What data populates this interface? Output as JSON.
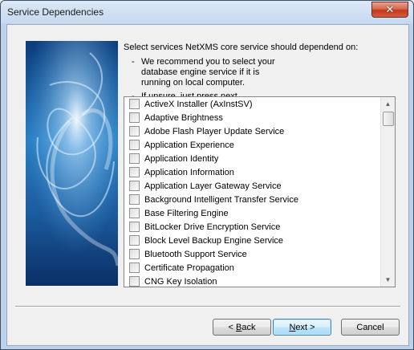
{
  "window": {
    "title": "Service Dependencies",
    "close_glyph": "✕"
  },
  "prompt": "Select services NetXMS core service should dependend on:",
  "bullets": [
    "We recommend you to select your database engine service if it is running on local computer.",
    "If unsure, just press next."
  ],
  "bullet_dash": "-",
  "services": [
    {
      "label": "ActiveX Installer (AxInstSV)",
      "checked": false
    },
    {
      "label": "Adaptive Brightness",
      "checked": false
    },
    {
      "label": "Adobe Flash Player Update Service",
      "checked": false
    },
    {
      "label": "Application Experience",
      "checked": false
    },
    {
      "label": "Application Identity",
      "checked": false
    },
    {
      "label": "Application Information",
      "checked": false
    },
    {
      "label": "Application Layer Gateway Service",
      "checked": false
    },
    {
      "label": "Background Intelligent Transfer Service",
      "checked": false
    },
    {
      "label": "Base Filtering Engine",
      "checked": false
    },
    {
      "label": "BitLocker Drive Encryption Service",
      "checked": false
    },
    {
      "label": "Block Level Backup Engine Service",
      "checked": false
    },
    {
      "label": "Bluetooth Support Service",
      "checked": false
    },
    {
      "label": "Certificate Propagation",
      "checked": false
    },
    {
      "label": "CNG Key Isolation",
      "checked": false
    }
  ],
  "scrollbar": {
    "up_icon": "▲",
    "down_icon": "▼"
  },
  "buttons": {
    "back": {
      "accel": "B",
      "rest": "ack",
      "prefix": "< "
    },
    "next": {
      "accel": "N",
      "rest": "ext",
      "suffix": " >"
    },
    "cancel": "Cancel"
  }
}
